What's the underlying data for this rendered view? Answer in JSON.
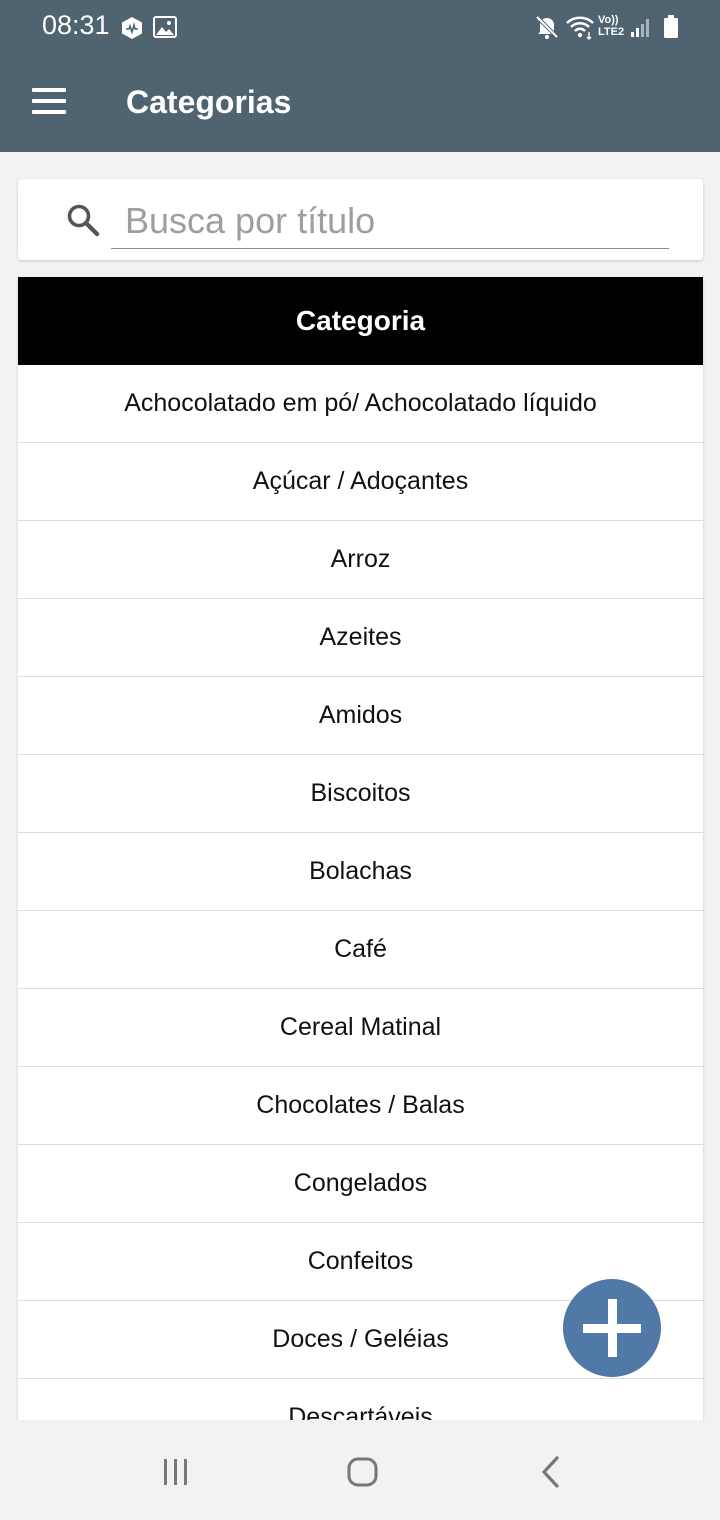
{
  "status_bar": {
    "time": "08:31",
    "left_icons": [
      "hexagon-app-icon",
      "image-icon"
    ],
    "right_icons": [
      "mute-icon",
      "wifi-icon",
      "volte-icon",
      "signal-icon",
      "battery-icon"
    ],
    "volte_label": "Vo)) LTE2"
  },
  "toolbar": {
    "title": "Categorias",
    "menu_icon": "hamburger-menu-icon",
    "background_color": "#4f6470"
  },
  "search": {
    "placeholder": "Busca por título",
    "value": "",
    "icon": "search-icon"
  },
  "table": {
    "header": "Categoria",
    "rows": [
      "Achocolatado em pó/ Achocolatado líquido",
      "Açúcar / Adoçantes",
      "Arroz",
      "Azeites",
      "Amidos",
      "Biscoitos",
      "Bolachas",
      "Café",
      "Cereal Matinal",
      "Chocolates / Balas",
      "Congelados",
      "Confeitos",
      "Doces / Geléias",
      "Descartáveis"
    ]
  },
  "fab": {
    "icon": "plus-icon",
    "color": "#5079a8"
  },
  "nav_bar": {
    "buttons": [
      "recent-apps-icon",
      "home-icon",
      "back-icon"
    ]
  }
}
